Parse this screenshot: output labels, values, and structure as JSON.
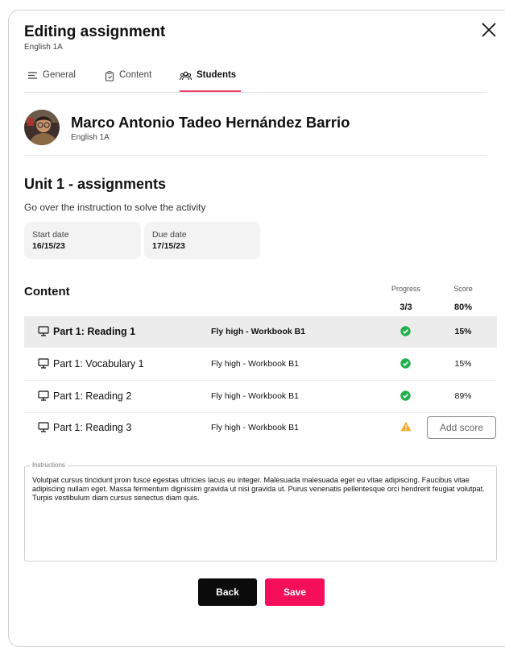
{
  "header": {
    "title": "Editing assignment",
    "subtitle": "English 1A"
  },
  "tabs": [
    {
      "label": "General",
      "icon": "lines-icon"
    },
    {
      "label": "Content",
      "icon": "clipboard-icon"
    },
    {
      "label": "Students",
      "icon": "group-icon",
      "active": true
    }
  ],
  "student": {
    "name": "Marco Antonio Tadeo Hernández Barrio",
    "class": "English 1A"
  },
  "unit": {
    "title": "Unit 1 - assignments",
    "description": "Go over the instruction to solve the  activity",
    "start_label": "Start date",
    "start_value": "16/15/23",
    "due_label": "Due date",
    "due_value": "17/15/23"
  },
  "content": {
    "title": "Content",
    "progress_header": "Progress",
    "score_header": "Score",
    "progress_total": "3/3",
    "score_total": "80%",
    "rows": [
      {
        "name": "Part 1: Reading 1",
        "book": "Fly high - Workbook B1",
        "status": "complete",
        "score": "15%"
      },
      {
        "name": "Part 1: Vocabulary 1",
        "book": "Fly high - Workbook B1",
        "status": "complete",
        "score": "15%"
      },
      {
        "name": "Part 1: Reading 2",
        "book": "Fly high - Workbook B1",
        "status": "complete",
        "score": "89%"
      },
      {
        "name": "Part 1: Reading 3",
        "book": "Fly high - Workbook B1",
        "status": "warning",
        "add_score_label": "Add score"
      }
    ]
  },
  "instructions": {
    "label": "Instructions",
    "text": "Volutpat cursus tincidunt proin fusce egestas ultricies lacus eu integer. Malesuada malesuada eget eu vitae adipiscing. Faucibus vitae adipiscing nullam eget. Massa fermentum dignissim gravida ut nisi gravida ut. Purus venenatis pellentesque orci hendrerit feugiat volutpat. Turpis vestibulum diam cursus senectus diam quis."
  },
  "actions": {
    "back_label": "Back",
    "save_label": "Save"
  },
  "colors": {
    "accent": "#f50f5a",
    "success": "#22b14c",
    "warning": "#f5a623",
    "selected_row": "#ececec"
  }
}
